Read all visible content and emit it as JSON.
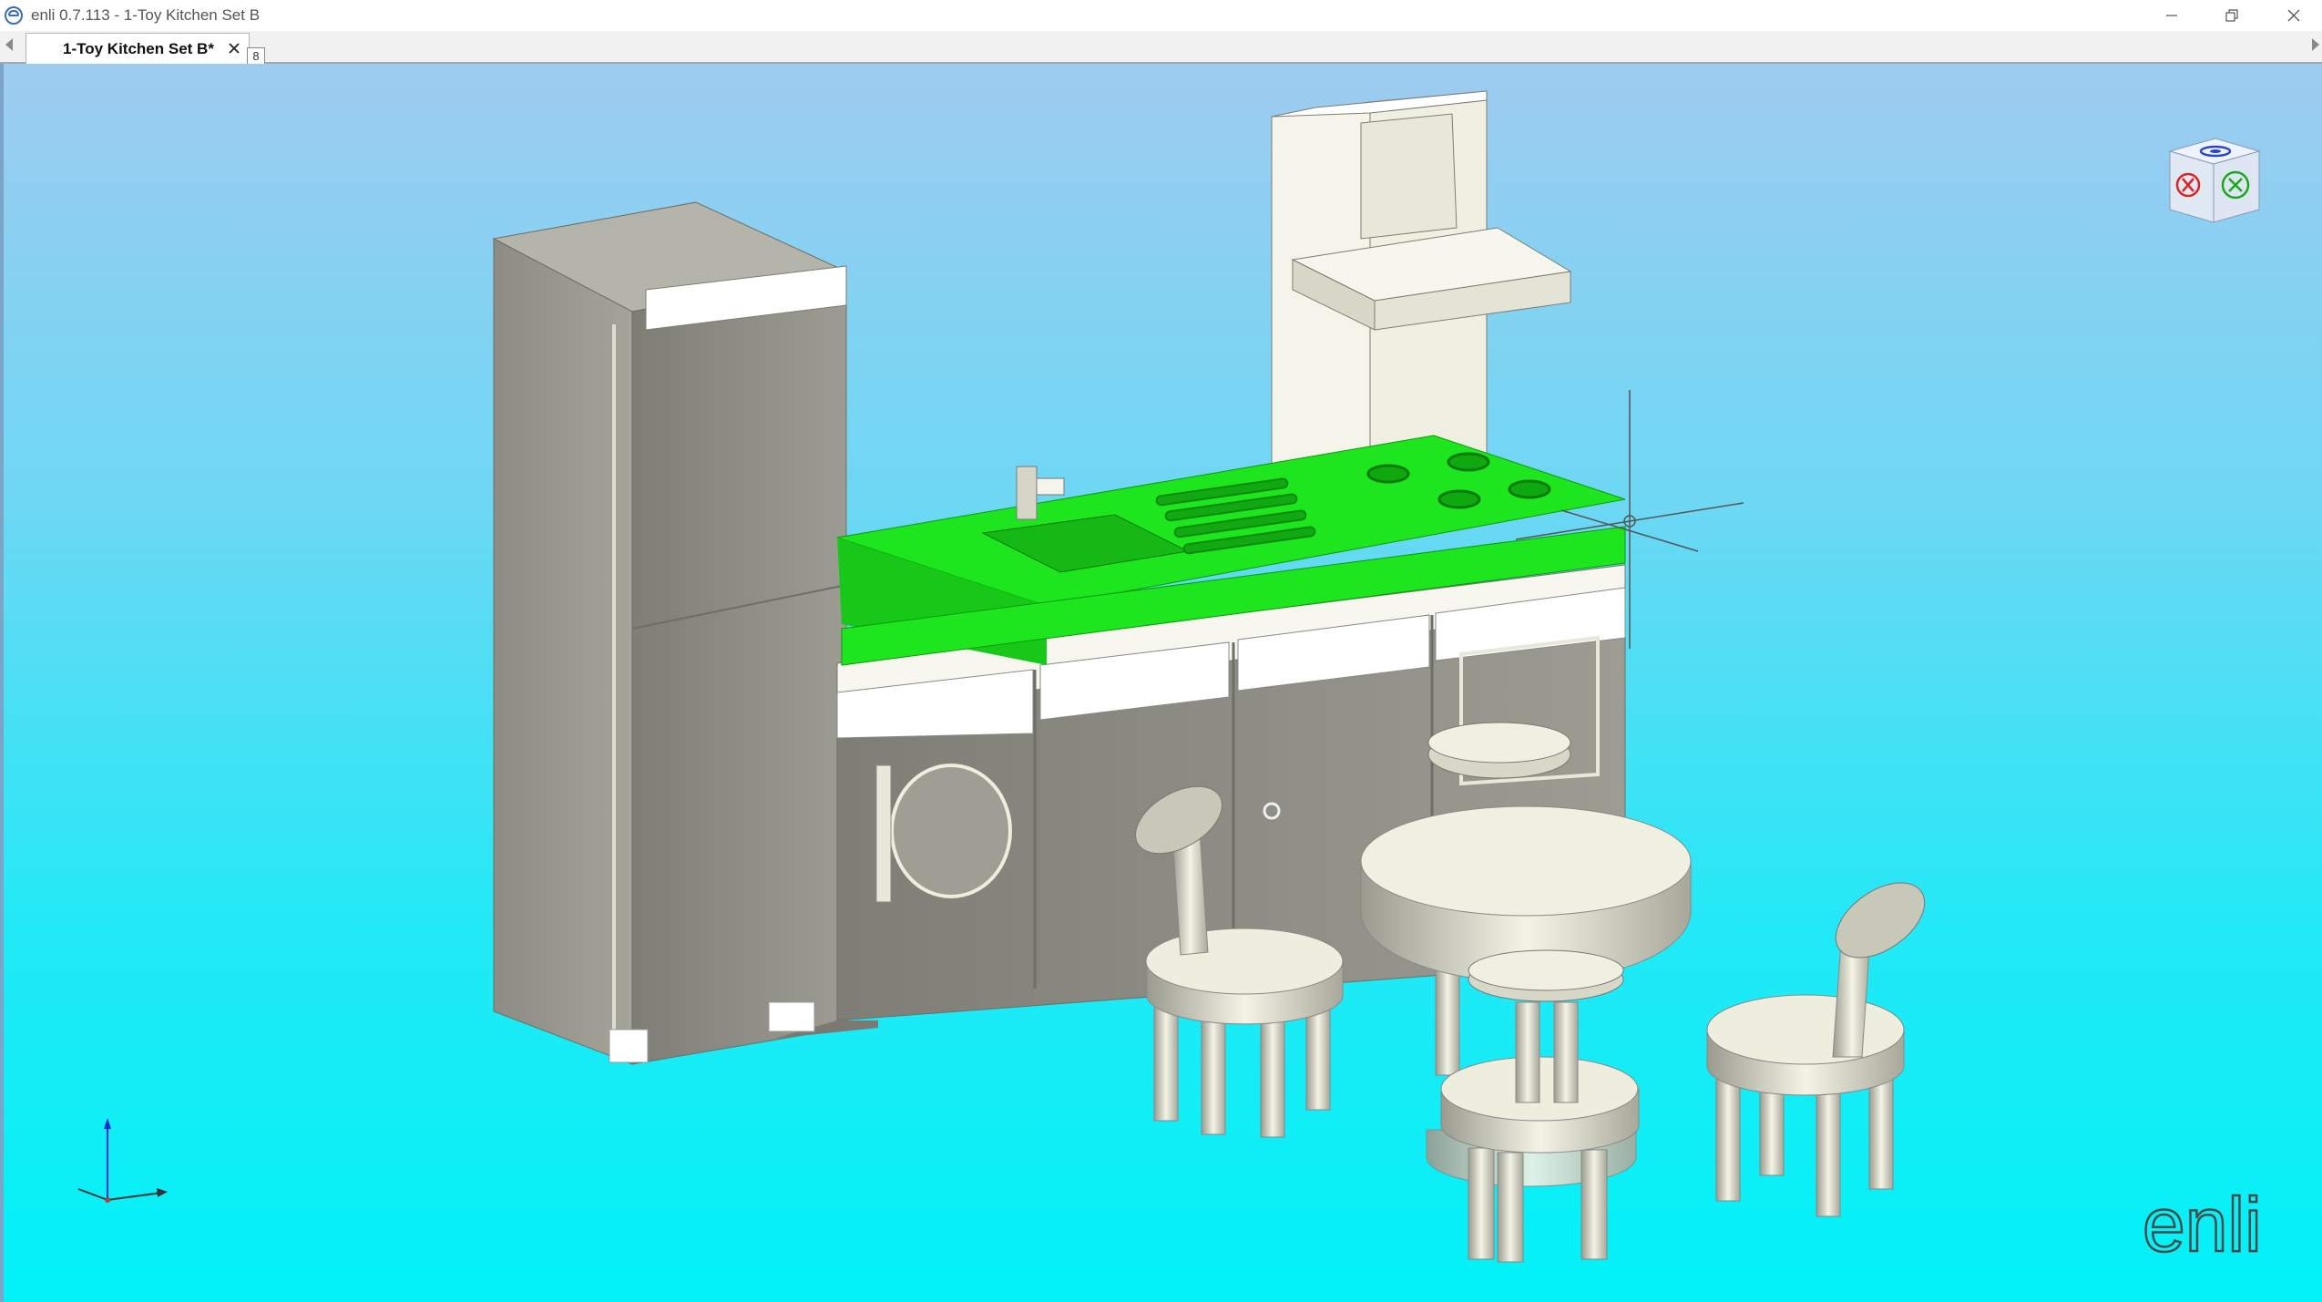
{
  "window": {
    "title": "enli 0.7.113 - 1-Toy Kitchen Set B",
    "minimize_icon": "minimize-icon",
    "restore_icon": "restore-icon",
    "close_icon": "close-icon"
  },
  "tabs": {
    "items": [
      {
        "label": "1-Toy Kitchen Set B*",
        "active": true
      }
    ],
    "overflow_count": "8"
  },
  "viewport": {
    "background_top": "#9ecbf0",
    "background_bottom": "#00f2f7",
    "highlight_color": "#1ee61e",
    "model_color": "#8a8a82"
  },
  "logo": {
    "text": "enli"
  }
}
